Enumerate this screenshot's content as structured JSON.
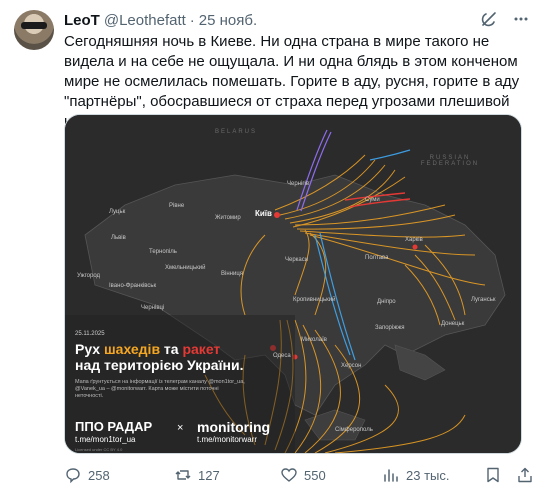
{
  "tweet": {
    "name": "LeoT",
    "handle": "@Leothefatt",
    "separator": "·",
    "time": "25 нояб.",
    "text": "Сегодняшняя ночь в Киеве. Ни одна страна в мире такого не видела и на себе не ощущала. И ни одна блядь в этом конченом мире не осмелилась помешать. Горите в аду, русня, горите в аду \"партнёры\", обосравшиеся от страха перед угрозами плешивой крысы. Скорее бы WWIII. Вы заслужили."
  },
  "media": {
    "countries": [
      "BELARUS",
      "RUSSIAN FEDERATION"
    ],
    "cities": {
      "kyiv": "Київ",
      "chernihiv": "Чернігів",
      "sumy": "Суми",
      "kharkiv": "Харків",
      "poltava": "Полтава",
      "lutsk": "Луцьк",
      "rivne": "Рівне",
      "lviv": "Львів",
      "zhytomyr": "Житомир",
      "ternopil": "Тернопіль",
      "khmelnytskyi": "Хмельницький",
      "vinnytsia": "Вінниця",
      "uzhhorod": "Ужгород",
      "ivano": "Івано-Франківськ",
      "chernivtsi": "Чернівці",
      "cherkasy": "Черкаси",
      "kropyvnytskyi": "Кропивницький",
      "dnipro": "Дніпро",
      "zaporizhzhia": "Запоріжжя",
      "donetsk": "Донецьк",
      "luhansk": "Луганськ",
      "mykolaiv": "Миколаїв",
      "kherson": "Херсон",
      "odesa": "Одеса",
      "simferopol": "Сімферополь"
    },
    "date": "25.11.2025",
    "headline_1": "Рух ",
    "headline_shahed": "шахедів",
    "headline_2": " та ",
    "headline_rockets": "ракет",
    "headline_3": "над територією України.",
    "note": "Мапа ґрунтується на інформації із телеграм каналу @mon1tor_ua, @Vanek_ua – @monitorwarr. Карта може містити поточні неточності.",
    "brand1": "ППО РАДАР",
    "brand1_sub": "t.me/mon1tor_ua",
    "brand_x": "×",
    "brand2": "monitoring",
    "brand2_sub": "t.me/monitorwarr",
    "license": "Licensed under CC BY 4.0",
    "colors": {
      "shahed": "#f5a623",
      "rocket": "#e53935",
      "missile_blue": "#3fa9f5",
      "missile_purple": "#8e6cf0"
    }
  },
  "actions": {
    "replies": "258",
    "retweets": "127",
    "likes": "550",
    "views": "23 тыс."
  }
}
